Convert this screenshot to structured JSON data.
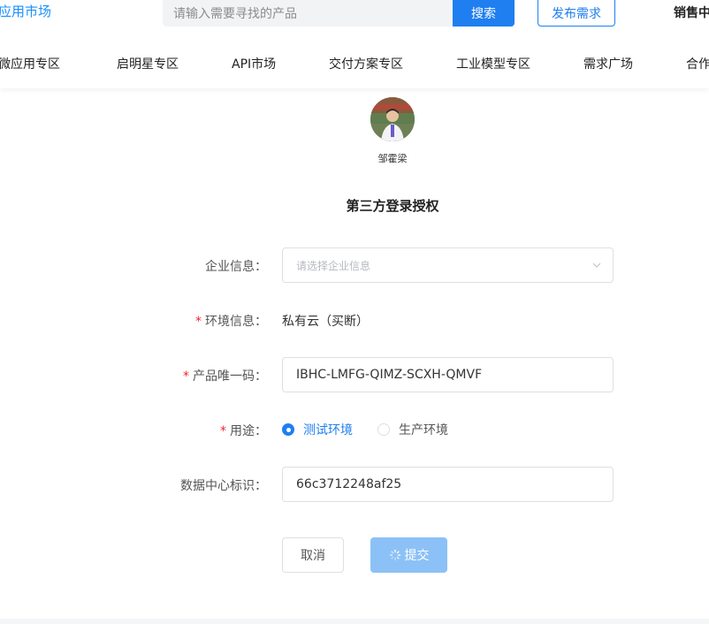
{
  "header": {
    "logo_text": "应用市场",
    "search_placeholder": "请输入需要寻找的产品",
    "search_button": "搜索",
    "publish_button": "发布需求",
    "sales_center": "销售中"
  },
  "nav": {
    "items": [
      "微应用专区",
      "启明星专区",
      "API市场",
      "交付方案专区",
      "工业模型专区",
      "需求广场",
      "合作"
    ]
  },
  "user": {
    "name": "邹霍梁"
  },
  "form": {
    "title": "第三方登录授权",
    "enterprise": {
      "label": "企业信息：",
      "placeholder": "请选择企业信息"
    },
    "environment": {
      "label": "环境信息：",
      "value": "私有云（买断）"
    },
    "product_code": {
      "label": "产品唯一码：",
      "value": "IBHC-LMFG-QIMZ-SCXH-QMVF"
    },
    "usage": {
      "label": "用途：",
      "options": [
        "测试环境",
        "生产环境"
      ],
      "selected": "测试环境"
    },
    "datacenter": {
      "label": "数据中心标识：",
      "value": "66c3712248af25"
    },
    "cancel_button": "取消",
    "submit_button": "提交"
  },
  "colors": {
    "primary": "#1f7ff0",
    "submit_loading": "#8cc1f7",
    "required": "#f5222d"
  }
}
